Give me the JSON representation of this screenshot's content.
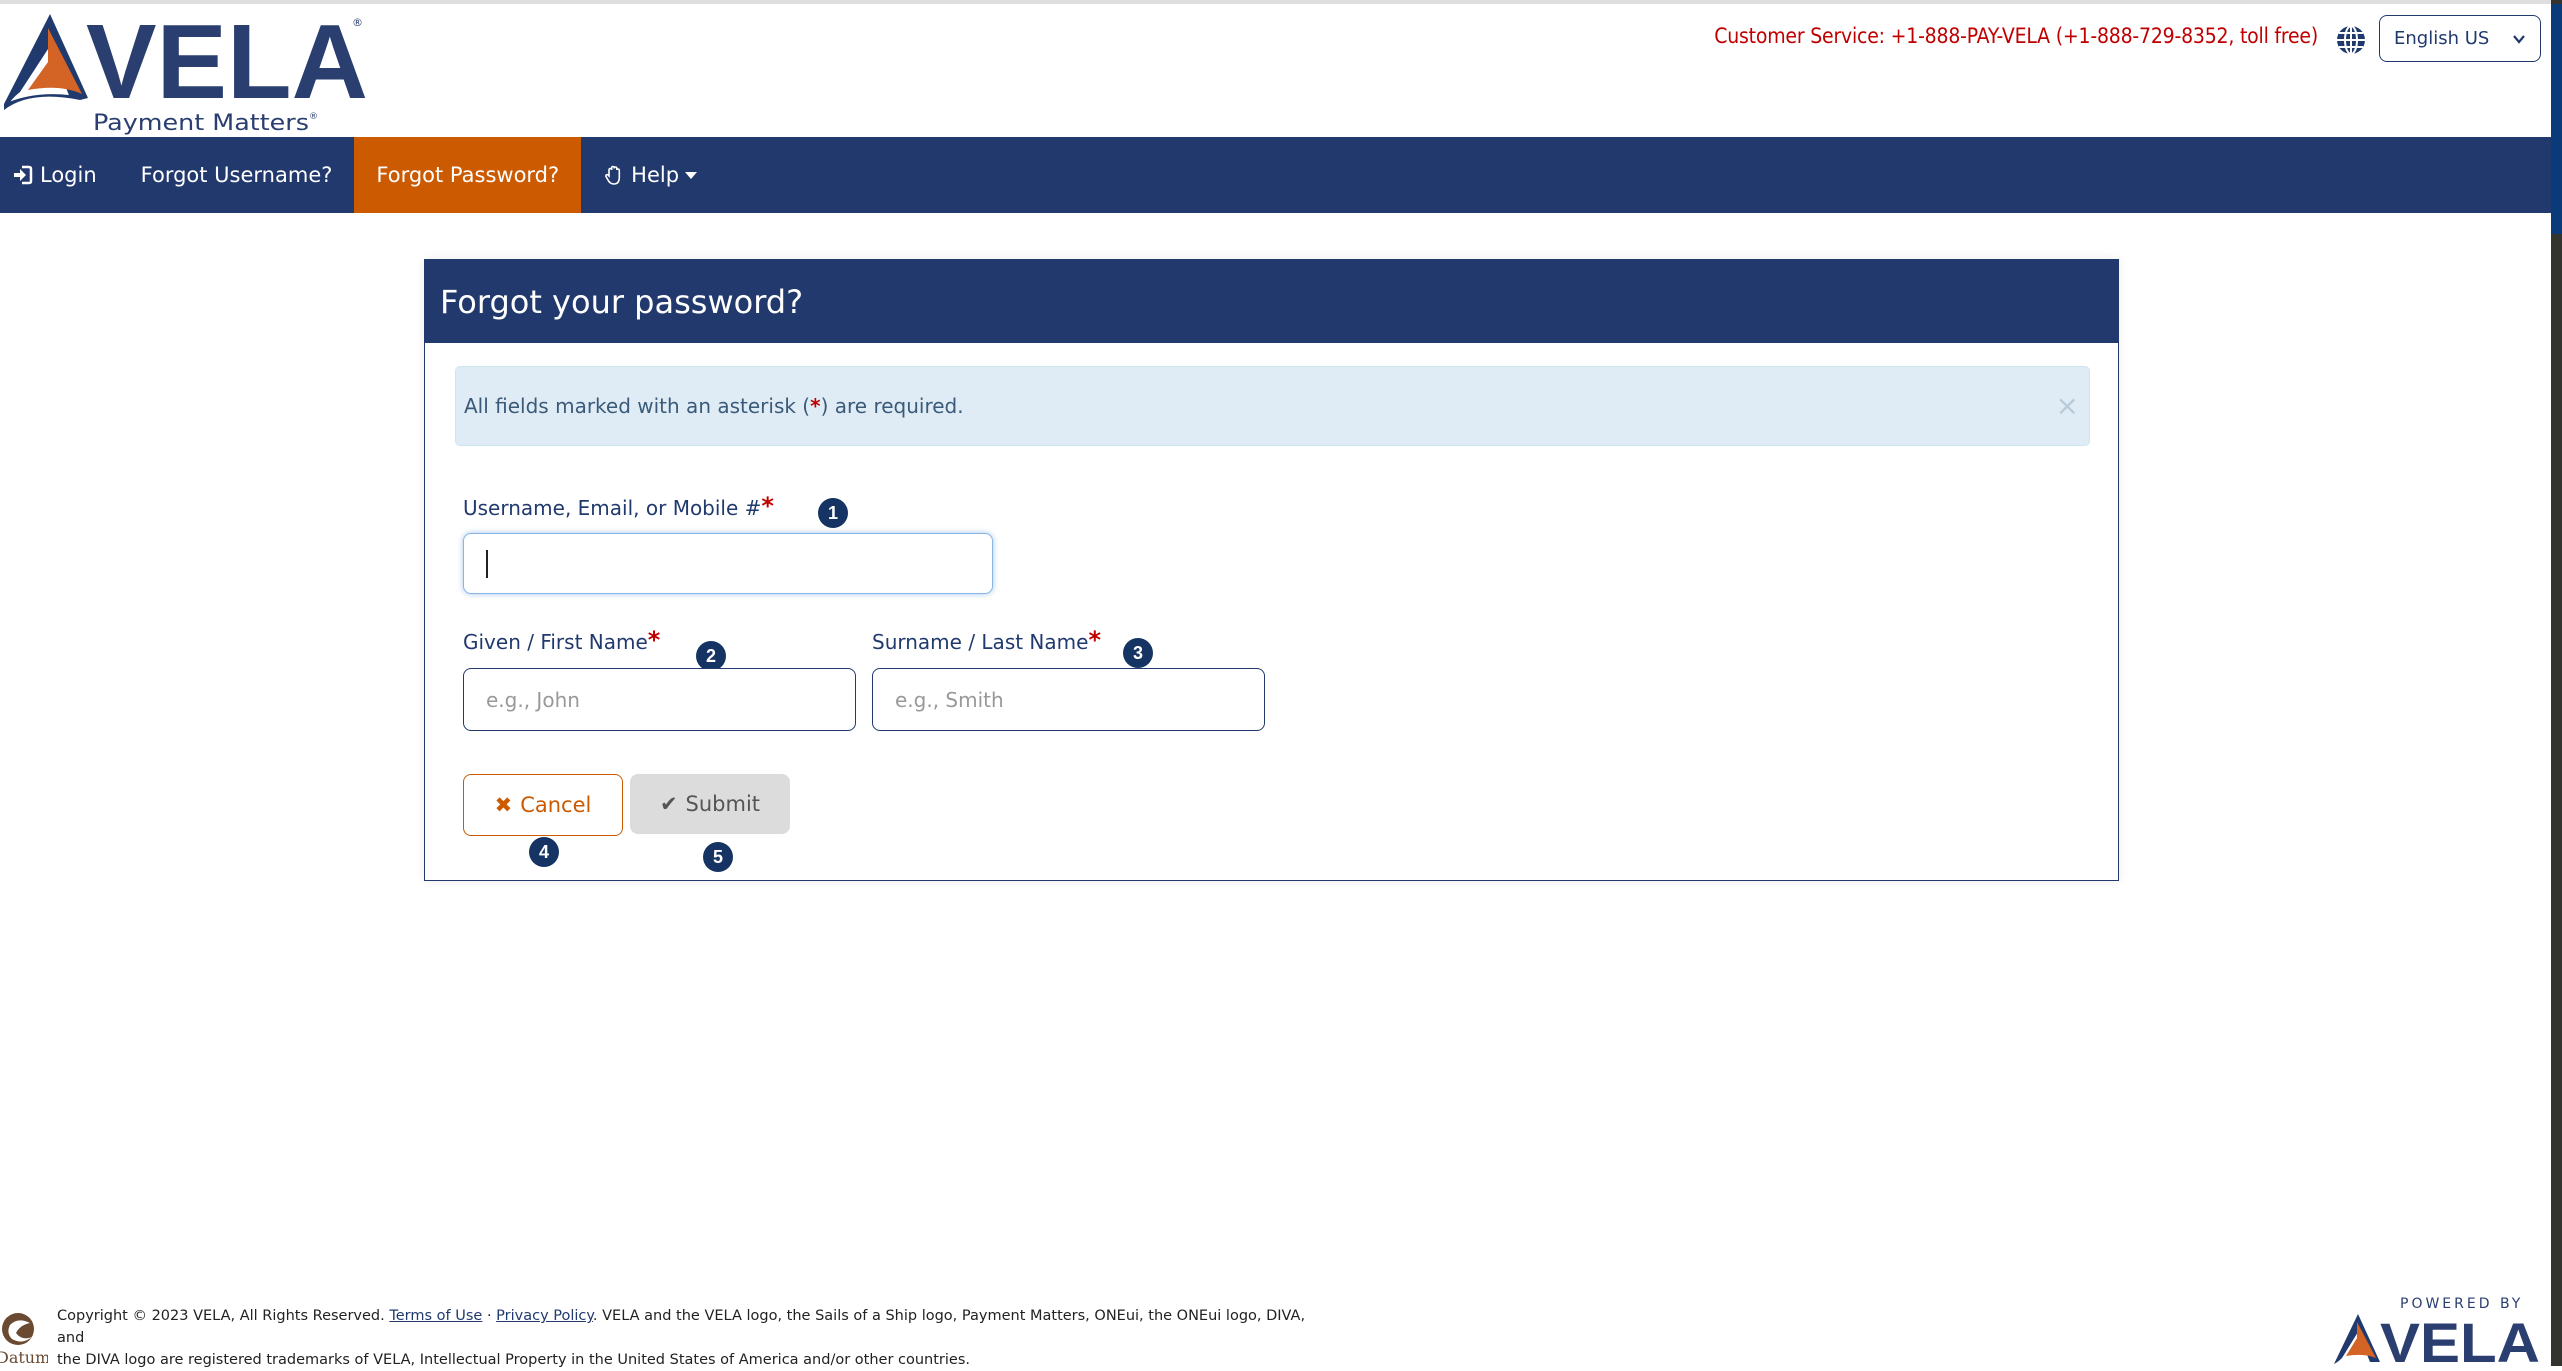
{
  "header": {
    "logo_brand": "VELA",
    "logo_tagline": "Payment Matters",
    "customer_service": "Customer Service: +1-888-PAY-VELA (+1-888-729-8352, toll free)",
    "language_selected": "English US",
    "icons": {
      "language": "globe-icon",
      "language_dropdown": "chevron-down-icon"
    }
  },
  "nav": {
    "items": [
      {
        "label": "Login",
        "icon": "sign-in-icon",
        "active": false
      },
      {
        "label": "Forgot Username?",
        "active": false
      },
      {
        "label": "Forgot Password?",
        "active": true
      },
      {
        "label": "Help",
        "icon": "hand-paper-icon",
        "dropdown": true,
        "active": false
      }
    ]
  },
  "panel": {
    "title": "Forgot your password?",
    "alert": {
      "text_before": "All fields marked with an asterisk (",
      "asterisk": "*",
      "text_after": ") are required.",
      "close": "×"
    },
    "fields": {
      "username": {
        "label": "Username, Email, or Mobile #",
        "required": "*",
        "value": "",
        "placeholder": "",
        "badge": "1"
      },
      "first_name": {
        "label": "Given / First Name",
        "required": "*",
        "value": "",
        "placeholder": "e.g., John",
        "badge": "2"
      },
      "last_name": {
        "label": "Surname / Last Name",
        "required": "*",
        "value": "",
        "placeholder": "e.g., Smith",
        "badge": "3"
      }
    },
    "buttons": {
      "cancel": {
        "label": "Cancel",
        "icon": "✖",
        "badge": "4"
      },
      "submit": {
        "label": "Submit",
        "icon": "✔",
        "badge": "5"
      }
    }
  },
  "footer": {
    "copyright": "Copyright © 2023 VELA, All Rights Reserved.",
    "terms": "Terms of Use",
    "separator": "·",
    "privacy": "Privacy Policy",
    "trademark_line1": ". VELA and the VELA logo, the Sails of a Ship logo, Payment Matters, ONEui, the ONEui logo, DIVA, and",
    "trademark_line2": "the DIVA logo are registered trademarks of VELA, Intellectual Property in the United States of America and/or other countries.",
    "datum_logo": "Datum",
    "powered_by": "POWERED BY",
    "powered_brand": "VELA"
  },
  "colors": {
    "primary_navy": "#22396e",
    "accent_orange": "#cc5a00",
    "required_red": "#c00000",
    "alert_bg": "#e0ecf5"
  }
}
